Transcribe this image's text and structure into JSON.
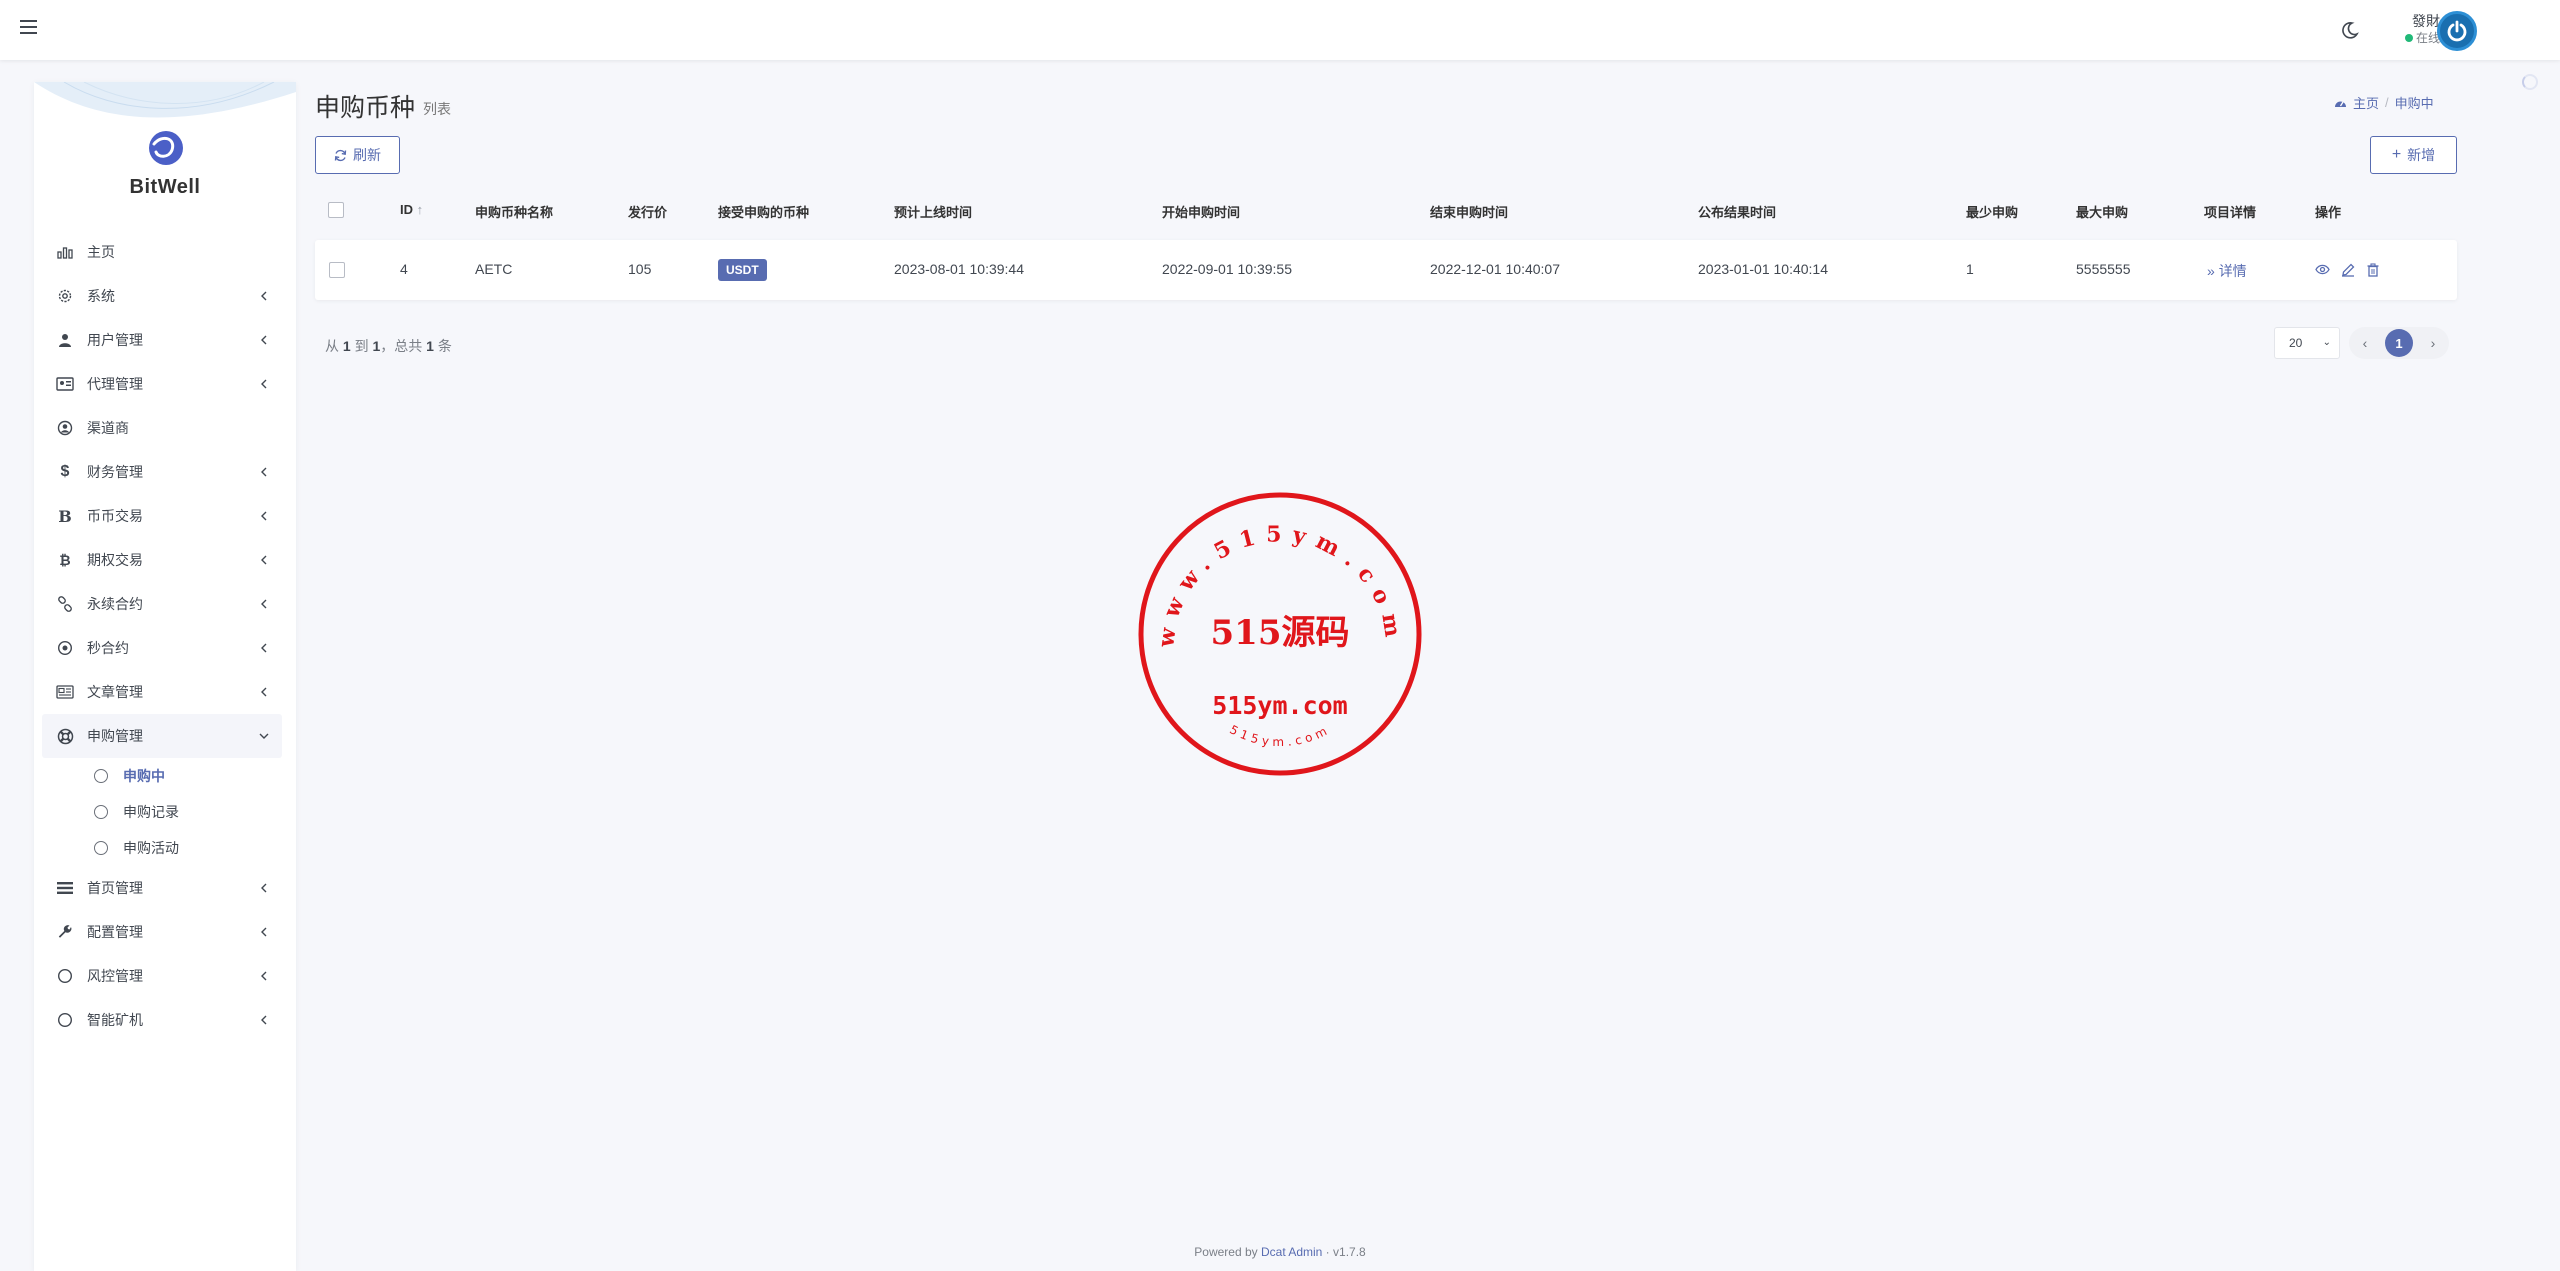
{
  "navbar": {
    "user_name": "發財",
    "user_status": "在线"
  },
  "brand": {
    "name": "BitWell"
  },
  "sidebar": {
    "items": [
      {
        "label": "主页",
        "icon": "chart-icon",
        "arrow": false
      },
      {
        "label": "系统",
        "icon": "gear-icon",
        "arrow": true
      },
      {
        "label": "用户管理",
        "icon": "users-icon",
        "arrow": true
      },
      {
        "label": "代理管理",
        "icon": "id-card-icon",
        "arrow": true
      },
      {
        "label": "渠道商",
        "icon": "user-circle-icon",
        "arrow": false
      },
      {
        "label": "财务管理",
        "icon": "dollar-icon",
        "arrow": true
      },
      {
        "label": "币币交易",
        "icon": "bitcoin-b-icon",
        "arrow": true
      },
      {
        "label": "期权交易",
        "icon": "bitcoin-icon",
        "arrow": true
      },
      {
        "label": "永续合约",
        "icon": "link-icon",
        "arrow": true
      },
      {
        "label": "秒合约",
        "icon": "dot-circle-icon",
        "arrow": true
      },
      {
        "label": "文章管理",
        "icon": "newspaper-icon",
        "arrow": true
      },
      {
        "label": "申购管理",
        "icon": "lifebuoy-icon",
        "arrow": true
      },
      {
        "label": "首页管理",
        "icon": "list-icon",
        "arrow": true
      },
      {
        "label": "配置管理",
        "icon": "wrench-icon",
        "arrow": true
      },
      {
        "label": "风控管理",
        "icon": "circle-icon",
        "arrow": true
      },
      {
        "label": "智能矿机",
        "icon": "circle-icon",
        "arrow": true
      }
    ],
    "submenu": [
      "申购中",
      "申购记录",
      "申购活动"
    ]
  },
  "header": {
    "title": "申购币种",
    "subtitle": "列表",
    "breadcrumb_home": "主页",
    "breadcrumb_current": "申购中"
  },
  "toolbar": {
    "refresh_label": "刷新",
    "new_label": "新增"
  },
  "table": {
    "columns": [
      "ID",
      "申购币种名称",
      "发行价",
      "接受申购的币种",
      "预计上线时间",
      "开始申购时间",
      "结束申购时间",
      "公布结果时间",
      "最少申购",
      "最大申购",
      "项目详情",
      "操作"
    ],
    "rows": [
      {
        "id": "4",
        "name": "AETC",
        "price": "105",
        "currency": "USDT",
        "launch_time": "2023-08-01 10:39:44",
        "start_time": "2022-09-01 10:39:55",
        "end_time": "2022-12-01 10:40:07",
        "result_time": "2023-01-01 10:40:14",
        "min": "1",
        "max": "5555555",
        "detail": "详情"
      }
    ]
  },
  "pager": {
    "from_label": "从",
    "from": "1",
    "to_label": "到",
    "to": "1",
    "total_label": "，总共",
    "total": "1",
    "unit": "条",
    "per_page": "20",
    "current_page": "1"
  },
  "stamp": {
    "ring_text": "www.515ym.com",
    "center_text": "515源码",
    "domain_text": "515ym.com",
    "bottom_text": "515ym.com",
    "color": "#e0161b"
  },
  "footer": {
    "prefix": "Powered by",
    "link": "Dcat Admin",
    "version": "v1.7.8"
  }
}
